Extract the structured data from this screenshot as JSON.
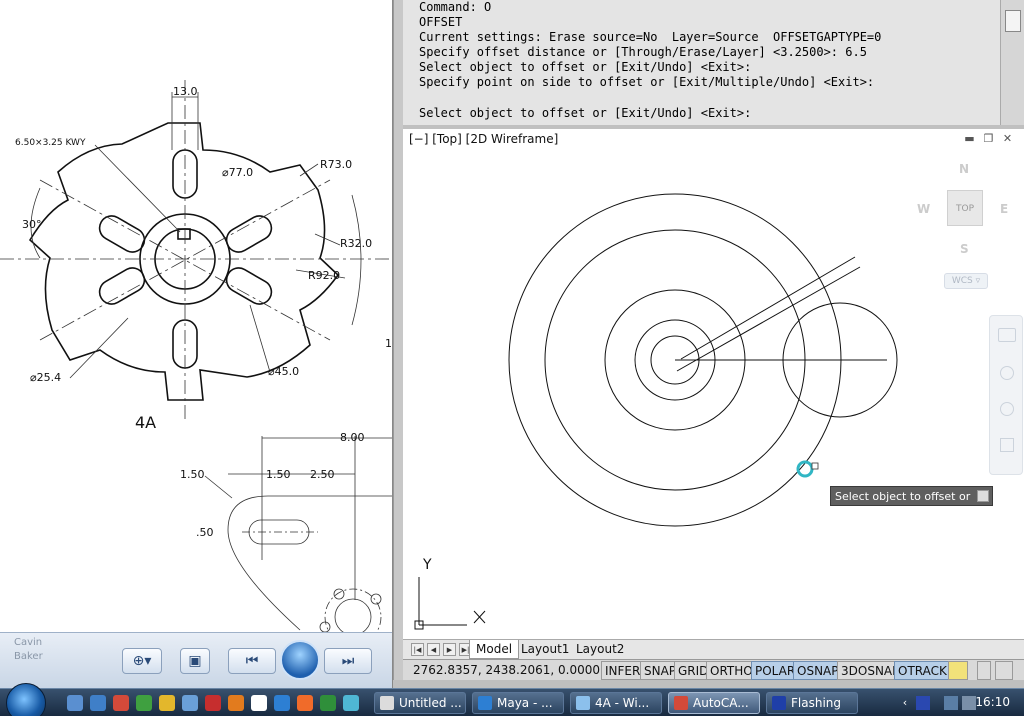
{
  "left_drawing": {
    "dims": {
      "slot_width": "13.0",
      "keyway": "6.50×3.25  KWY",
      "r_outer": "R73.0",
      "d_77": "⌀77.0",
      "angle": "30°",
      "r_32": "R32.0",
      "r_92": "R92.0",
      "d_25": "⌀25.4",
      "d_45": "⌀45.0",
      "d_8": "8.00",
      "d_150a": "1.50",
      "d_150b": "1.50",
      "d_250": "2.50",
      "d_50": ".50"
    },
    "part_label": "4A",
    "side_char": "1"
  },
  "viewer_bar": {
    "left_text_1": "Cavin",
    "left_text_2": "Baker",
    "zoom_label": "⊕▾",
    "fit_label": "▣",
    "prev_label": "⏮",
    "next_label": "⏭",
    "rotate_label": "↻",
    "delete_label": "✕"
  },
  "command": {
    "lines": [
      "Command: O",
      "OFFSET",
      "Current settings: Erase source=No  Layer=Source  OFFSETGAPTYPE=0",
      "Specify offset distance or [Through/Erase/Layer] <3.2500>: 6.5",
      "Select object to offset or [Exit/Undo] <Exit>:",
      "Specify point on side to offset or [Exit/Multiple/Undo] <Exit>:"
    ],
    "prompt": "Select object to offset or [Exit/Undo] <Exit>:"
  },
  "viewport": {
    "label": "[−] [Top] [2D Wireframe]",
    "min": "▬",
    "restore": "❐",
    "close": "✕",
    "viewcube": {
      "n": "N",
      "s": "S",
      "e": "E",
      "w": "W",
      "face": "TOP",
      "wcs": "WCS ▿"
    },
    "ucs": {
      "y": "Y",
      "x": "X"
    },
    "tooltip": "Select object to offset or"
  },
  "tabs": {
    "nav": [
      "|◀",
      "◀",
      "▶",
      "▶|"
    ],
    "items": [
      "Model",
      "Layout1",
      "Layout2"
    ]
  },
  "status": {
    "coords": "2762.8357, 2438.2061, 0.0000",
    "buttons": [
      {
        "label": "INFER",
        "on": false
      },
      {
        "label": "SNAP",
        "on": false
      },
      {
        "label": "GRID",
        "on": false
      },
      {
        "label": "ORTHO",
        "on": false
      },
      {
        "label": "POLAR",
        "on": true
      },
      {
        "label": "OSNAP",
        "on": true
      },
      {
        "label": "3DOSNAP",
        "on": false
      },
      {
        "label": "OTRACK",
        "on": true
      }
    ]
  },
  "taskbar": {
    "tasks": [
      {
        "label": "Untitled ...",
        "active": false
      },
      {
        "label": "Maya - ...",
        "active": false
      },
      {
        "label": "4A - Wi...",
        "active": false
      },
      {
        "label": "AutoCA...",
        "active": true
      },
      {
        "label": "Flashing",
        "active": false
      }
    ],
    "clock": "16:10",
    "tray_chevron": "‹"
  },
  "colors": {
    "accent": "#1e5fae",
    "taskbar": "#182a40",
    "cursor": "#31b6c4"
  }
}
